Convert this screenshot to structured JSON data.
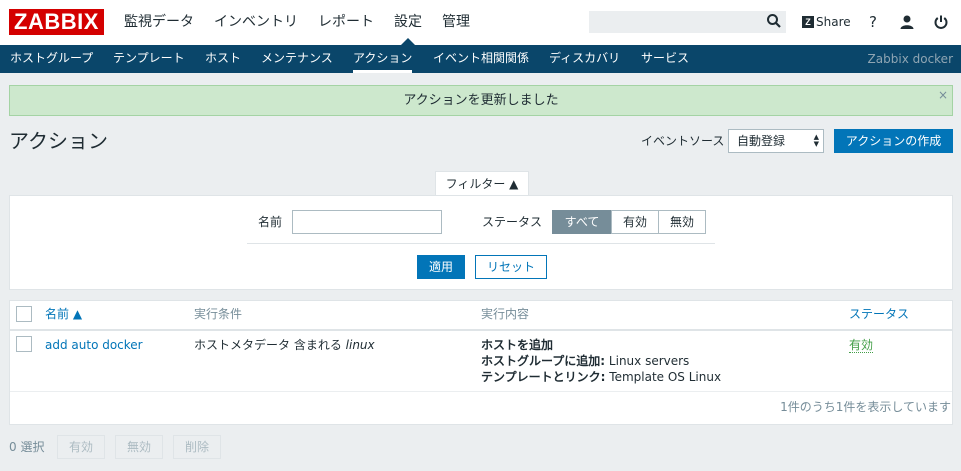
{
  "header": {
    "logo": "ZABBIX",
    "menu": [
      "監視データ",
      "インベントリ",
      "レポート",
      "設定",
      "管理"
    ],
    "active_menu": "設定",
    "search_value": "",
    "share_label": "Share",
    "help_label": "?"
  },
  "subnav": {
    "items": [
      "ホストグループ",
      "テンプレート",
      "ホスト",
      "メンテナンス",
      "アクション",
      "イベント相関関係",
      "ディスカバリ",
      "サービス"
    ],
    "active": "アクション",
    "server_name": "Zabbix docker"
  },
  "message": {
    "text": "アクションを更新しました",
    "close": "×"
  },
  "page": {
    "title": "アクション",
    "event_source_label": "イベントソース",
    "event_source_value": "自動登録",
    "create_button": "アクションの作成"
  },
  "filter": {
    "tab_label": "フィルター ▲",
    "name_label": "名前",
    "name_value": "",
    "status_label": "ステータス",
    "status_options": [
      "すべて",
      "有効",
      "無効"
    ],
    "status_selected": "すべて",
    "apply": "適用",
    "reset": "リセット"
  },
  "table": {
    "columns": [
      "名前 ▲",
      "実行条件",
      "実行内容",
      "ステータス"
    ],
    "rows": [
      {
        "name": "add auto docker",
        "condition_text": "ホストメタデータ 含まれる",
        "condition_value": "linux",
        "operations": [
          {
            "label": "ホストを追加",
            "value": ""
          },
          {
            "label": "ホストグループに追加:",
            "value": "Linux servers"
          },
          {
            "label": "テンプレートとリンク:",
            "value": "Template OS Linux"
          }
        ],
        "status": "有効"
      }
    ],
    "paging": "1件のうち1件を表示しています"
  },
  "footer": {
    "selected": "0 選択",
    "buttons": [
      "有効",
      "無効",
      "削除"
    ]
  },
  "colors": {
    "brand": "#d40000",
    "nav": "#0a466a",
    "primary": "#0275b8",
    "success_bg": "#cde8cd",
    "status_enabled": "#429e47"
  }
}
